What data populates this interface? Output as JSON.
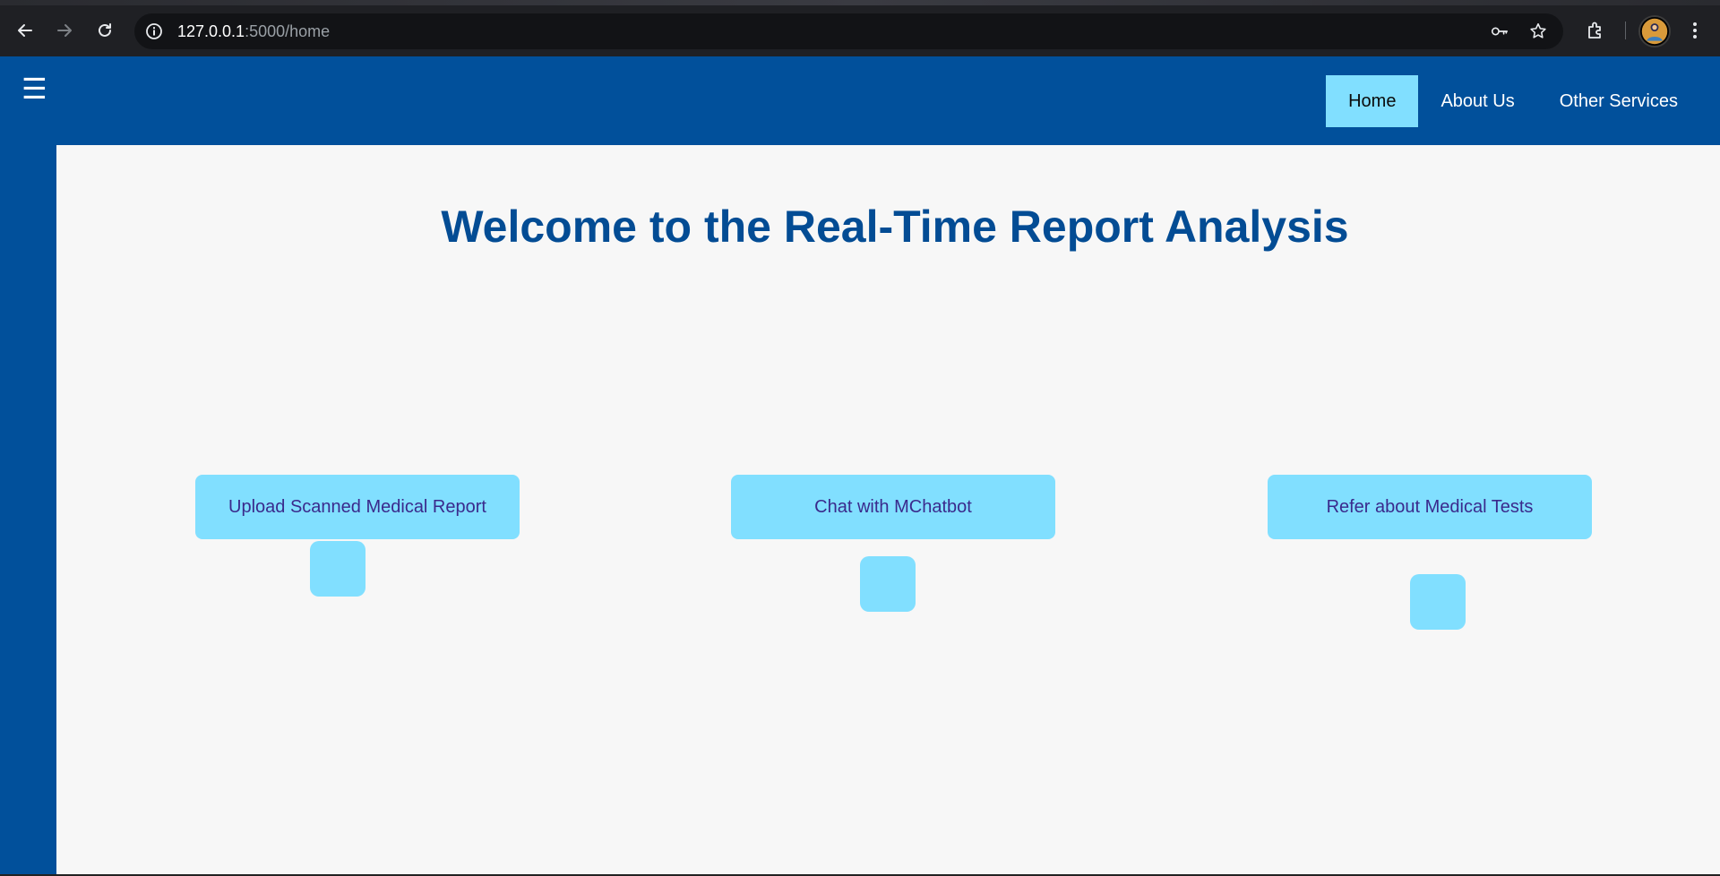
{
  "browser": {
    "url_host": "127.0.0.1",
    "url_rest": ":5000/home"
  },
  "header": {
    "menu_glyph": "☰",
    "nav": [
      {
        "label": "Home",
        "active": true
      },
      {
        "label": "About Us",
        "active": false
      },
      {
        "label": "Other Services",
        "active": false
      }
    ]
  },
  "main": {
    "title": "Welcome to the Real-Time Report Analysis",
    "actions": [
      {
        "label": "Upload Scanned Medical Report"
      },
      {
        "label": "Chat with MChatbot"
      },
      {
        "label": "Refer about Medical Tests"
      }
    ]
  },
  "colors": {
    "header_bg": "#01509b",
    "accent": "#81dfff",
    "title": "#034c94",
    "content_bg": "#f7f7f7"
  }
}
